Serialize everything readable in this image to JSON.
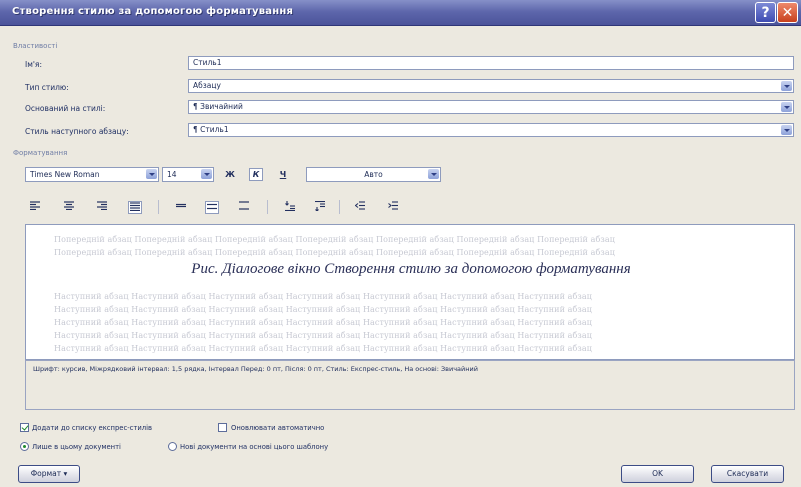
{
  "window": {
    "title": "Створення стилю за допомогою форматування",
    "help_label": "?",
    "close_label": "✕"
  },
  "properties": {
    "section_label": "Властивості",
    "name_label": "Ім'я:",
    "name_value": "Стиль1",
    "type_label": "Тип стилю:",
    "type_value": "Абзацу",
    "based_label": "Оснований на стилі:",
    "based_value": "¶ Звичайний",
    "next_label": "Стиль наступного абзацу:",
    "next_value": "¶ Стиль1"
  },
  "formatting": {
    "section_label": "Форматування",
    "font_name": "Times New Roman",
    "font_size": "14",
    "bold_label": "Ж",
    "italic_label": "К",
    "underline_label": "Ч",
    "color_value": "Авто",
    "align_icons": [
      "align-left-icon",
      "align-center-icon",
      "align-right-icon",
      "align-justify-icon"
    ],
    "spacing_icons": [
      "single-spacing-icon",
      "one-half-spacing-icon",
      "double-spacing-icon"
    ]
  },
  "preview": {
    "prev_line": "Попередній абзац Попередній абзац Попередній абзац Попередній абзац Попередній абзац Попередній абзац Попередній абзац",
    "caption": "Рис. Діалогове вікно Створення стилю за допомогою форматування",
    "next_line": "Наступний абзац Наступний абзац Наступний абзац Наступний абзац Наступний абзац Наступний абзац Наступний абзац"
  },
  "description": "Шрифт: курсив, Міжрядковий інтервал: 1,5 рядка, Інтервал Перед: 0 пт, Після: 0 пт, Стиль: Експрес-стиль, На основі: Звичайний",
  "options": {
    "add_quick_label": "Додати до списку експрес-стилів",
    "add_quick_checked": true,
    "auto_update_label": "Оновлювати автоматично",
    "auto_update_checked": false,
    "only_doc_label": "Лише в цьому документі",
    "new_docs_label": "Нові документи на основі цього шаблону"
  },
  "buttons": {
    "format_label": "Формат ▾",
    "ok_label": "OK",
    "cancel_label": "Скасувати"
  },
  "colors": {
    "titlebar": "#5d66ab",
    "dialog_bg": "#ece9e0",
    "close_button": "#c8401d"
  }
}
